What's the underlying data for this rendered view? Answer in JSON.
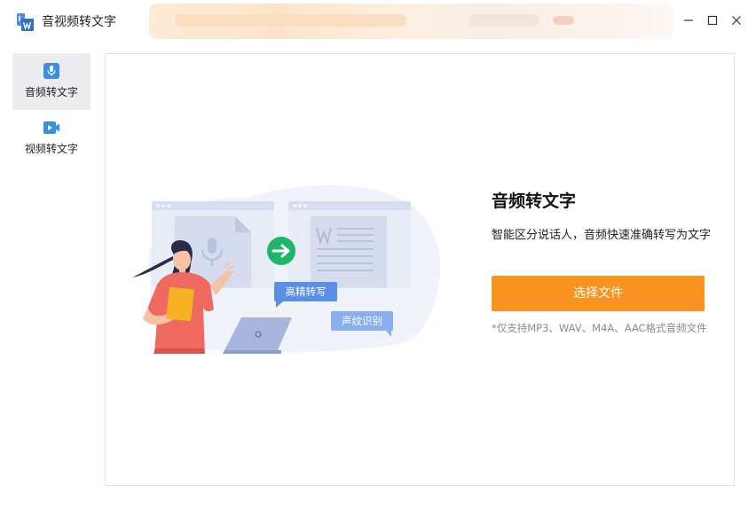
{
  "window": {
    "title": "音视频转文字",
    "controls": {
      "minimize_icon": "minimize-icon",
      "maximize_icon": "maximize-icon",
      "close_icon": "close-icon"
    }
  },
  "sidebar": {
    "items": [
      {
        "label": "音频转文字",
        "icon": "microphone-icon",
        "active": true
      },
      {
        "label": "视频转文字",
        "icon": "video-camera-icon",
        "active": false
      }
    ]
  },
  "main": {
    "illustration": {
      "bubble_hd": "高精转写",
      "bubble_voiceprint": "声纹识别"
    },
    "title": "音频转文字",
    "description": "智能区分说话人，音频快速准确转写为文字",
    "select_button": "选择文件",
    "formats_note": "*仅支持MP3、WAV、M4A、AAC格式音频文件"
  },
  "colors": {
    "accent_orange": "#f7931e",
    "brand_blue": "#3a8ee6",
    "arrow_green": "#21b46b"
  }
}
